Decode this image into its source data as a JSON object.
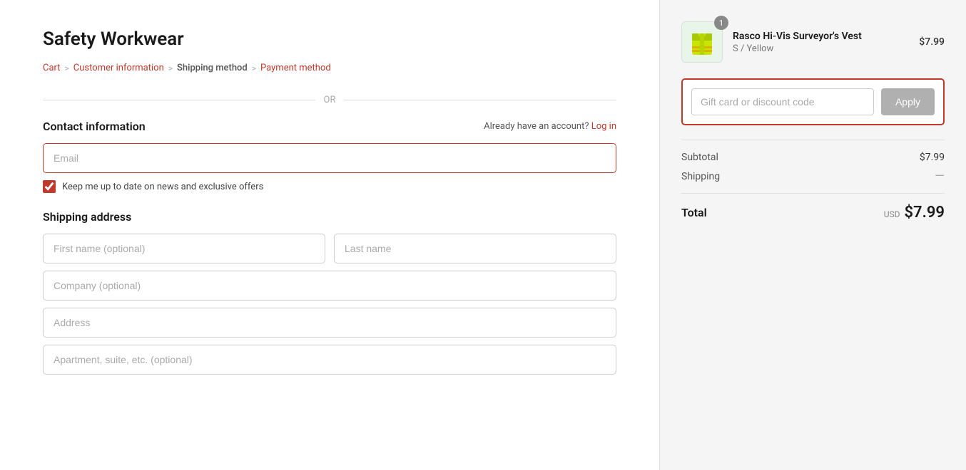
{
  "store": {
    "title": "Safety Workwear"
  },
  "breadcrumb": {
    "items": [
      {
        "label": "Cart",
        "active": false
      },
      {
        "label": "Customer information",
        "active": false
      },
      {
        "label": "Shipping method",
        "active": true
      },
      {
        "label": "Payment method",
        "active": false
      }
    ],
    "separators": [
      ">",
      ">",
      ">"
    ]
  },
  "divider": {
    "text": "OR"
  },
  "contact": {
    "title": "Contact information",
    "account_prompt": "Already have an account?",
    "login_label": "Log in",
    "email_placeholder": "Email",
    "checkbox_label": "Keep me up to date on news and exclusive offers",
    "checkbox_checked": true
  },
  "shipping": {
    "title": "Shipping address",
    "first_name_placeholder": "First name (optional)",
    "last_name_placeholder": "Last name",
    "company_placeholder": "Company (optional)",
    "address_placeholder": "Address",
    "apt_placeholder": "Apartment, suite, etc. (optional)"
  },
  "product": {
    "name": "Rasco Hi-Vis Surveyor's Vest",
    "variant": "S / Yellow",
    "price": "$7.99",
    "quantity": "1"
  },
  "discount": {
    "placeholder": "Gift card or discount code",
    "apply_label": "Apply"
  },
  "totals": {
    "subtotal_label": "Subtotal",
    "subtotal_value": "$7.99",
    "shipping_label": "Shipping",
    "shipping_value": "—",
    "total_label": "Total",
    "total_currency": "USD",
    "total_amount": "$7.99"
  }
}
